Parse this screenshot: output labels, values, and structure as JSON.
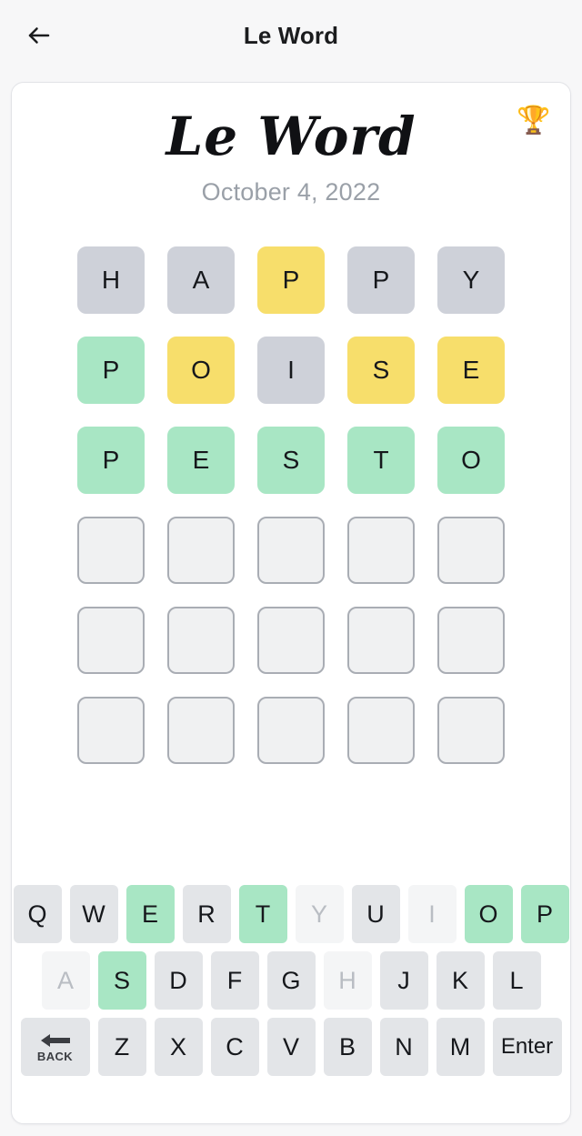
{
  "navbar": {
    "back_icon": "arrow-left-icon",
    "title": "Le Word"
  },
  "logo": {
    "title": "Le Word",
    "date": "October 4, 2022",
    "trophy_icon": "🏆"
  },
  "colors": {
    "correct": "#a8e6c4",
    "present": "#f7de6b",
    "absent": "#ced1d9",
    "empty": "#f0f1f2",
    "empty_border": "#a9adb4",
    "key_default": "#e3e5e8",
    "key_disabled": "#f4f5f6",
    "page_bg": "#f7f7f8",
    "card_bg": "#ffffff",
    "date_text": "#9aa0a8"
  },
  "board": {
    "rows": 6,
    "cols": 5,
    "guesses": [
      {
        "word": "HAPPY",
        "tiles": [
          {
            "letter": "H",
            "state": "absent"
          },
          {
            "letter": "A",
            "state": "absent"
          },
          {
            "letter": "P",
            "state": "present"
          },
          {
            "letter": "P",
            "state": "absent"
          },
          {
            "letter": "Y",
            "state": "absent"
          }
        ]
      },
      {
        "word": "POISE",
        "tiles": [
          {
            "letter": "P",
            "state": "correct"
          },
          {
            "letter": "O",
            "state": "present"
          },
          {
            "letter": "I",
            "state": "absent"
          },
          {
            "letter": "S",
            "state": "present"
          },
          {
            "letter": "E",
            "state": "present"
          }
        ]
      },
      {
        "word": "PESTO",
        "tiles": [
          {
            "letter": "P",
            "state": "correct"
          },
          {
            "letter": "E",
            "state": "correct"
          },
          {
            "letter": "S",
            "state": "correct"
          },
          {
            "letter": "T",
            "state": "correct"
          },
          {
            "letter": "O",
            "state": "correct"
          }
        ]
      },
      {
        "word": "",
        "tiles": [
          {
            "letter": "",
            "state": "empty"
          },
          {
            "letter": "",
            "state": "empty"
          },
          {
            "letter": "",
            "state": "empty"
          },
          {
            "letter": "",
            "state": "empty"
          },
          {
            "letter": "",
            "state": "empty"
          }
        ]
      },
      {
        "word": "",
        "tiles": [
          {
            "letter": "",
            "state": "empty"
          },
          {
            "letter": "",
            "state": "empty"
          },
          {
            "letter": "",
            "state": "empty"
          },
          {
            "letter": "",
            "state": "empty"
          },
          {
            "letter": "",
            "state": "empty"
          }
        ]
      },
      {
        "word": "",
        "tiles": [
          {
            "letter": "",
            "state": "empty"
          },
          {
            "letter": "",
            "state": "empty"
          },
          {
            "letter": "",
            "state": "empty"
          },
          {
            "letter": "",
            "state": "empty"
          },
          {
            "letter": "",
            "state": "empty"
          }
        ]
      }
    ]
  },
  "keyboard": {
    "rows": [
      [
        {
          "label": "Q",
          "state": "default"
        },
        {
          "label": "W",
          "state": "default"
        },
        {
          "label": "E",
          "state": "correct"
        },
        {
          "label": "R",
          "state": "default"
        },
        {
          "label": "T",
          "state": "correct"
        },
        {
          "label": "Y",
          "state": "absent"
        },
        {
          "label": "U",
          "state": "default"
        },
        {
          "label": "I",
          "state": "absent"
        },
        {
          "label": "O",
          "state": "correct"
        },
        {
          "label": "P",
          "state": "correct"
        }
      ],
      [
        {
          "label": "A",
          "state": "absent"
        },
        {
          "label": "S",
          "state": "correct"
        },
        {
          "label": "D",
          "state": "default"
        },
        {
          "label": "F",
          "state": "default"
        },
        {
          "label": "G",
          "state": "default"
        },
        {
          "label": "H",
          "state": "absent"
        },
        {
          "label": "J",
          "state": "default"
        },
        {
          "label": "K",
          "state": "default"
        },
        {
          "label": "L",
          "state": "default"
        }
      ],
      [
        {
          "label": "BACK",
          "state": "default",
          "kind": "back",
          "icon": "arrow-left-icon"
        },
        {
          "label": "Z",
          "state": "default"
        },
        {
          "label": "X",
          "state": "default"
        },
        {
          "label": "C",
          "state": "default"
        },
        {
          "label": "V",
          "state": "default"
        },
        {
          "label": "B",
          "state": "default"
        },
        {
          "label": "N",
          "state": "default"
        },
        {
          "label": "M",
          "state": "default"
        },
        {
          "label": "Enter",
          "state": "default",
          "kind": "wide"
        }
      ]
    ]
  }
}
